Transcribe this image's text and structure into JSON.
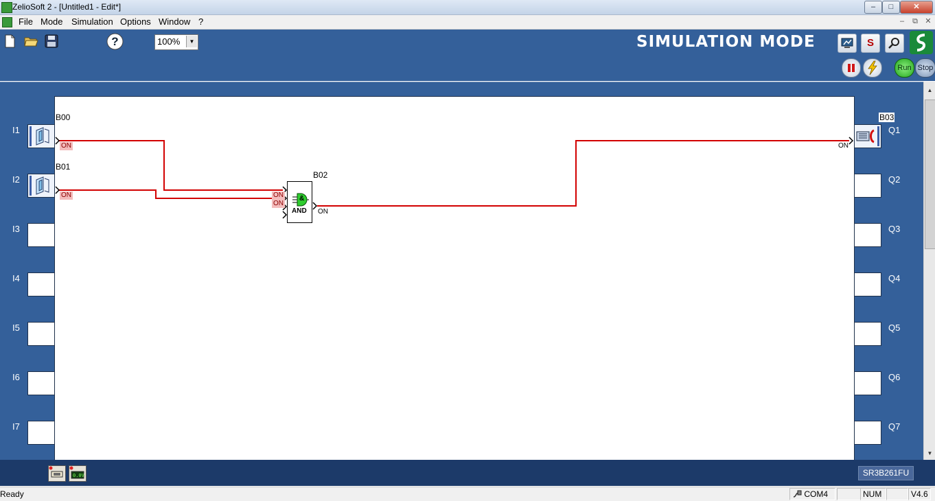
{
  "window": {
    "title": "ZelioSoft 2 - [Untitled1 - Edit*]",
    "controls": {
      "minimize": "–",
      "maximize": "□",
      "close": "✕"
    }
  },
  "menu": {
    "items": [
      "File",
      "Mode",
      "Simulation",
      "Options",
      "Window",
      "?"
    ],
    "mdi_controls": {
      "minimize": "–",
      "restore": "⧉",
      "close": "✕"
    }
  },
  "toolbar": {
    "zoom": "100%",
    "mode_banner": "SIMULATION MODE",
    "s_button": "S",
    "run_label": "Run",
    "stop_label": "Stop"
  },
  "diagram": {
    "inputs": [
      {
        "label": "I1",
        "block": "B00",
        "state": "ON",
        "used": true
      },
      {
        "label": "I2",
        "block": "B01",
        "state": "ON",
        "used": true
      },
      {
        "label": "I3",
        "used": false
      },
      {
        "label": "I4",
        "used": false
      },
      {
        "label": "I5",
        "used": false
      },
      {
        "label": "I6",
        "used": false
      },
      {
        "label": "I7",
        "used": false
      }
    ],
    "outputs": [
      {
        "label": "Q1",
        "block": "B03",
        "state": "ON",
        "used": true
      },
      {
        "label": "Q2",
        "used": false
      },
      {
        "label": "Q3",
        "used": false
      },
      {
        "label": "Q4",
        "used": false
      },
      {
        "label": "Q5",
        "used": false
      },
      {
        "label": "Q6",
        "used": false
      },
      {
        "label": "Q7",
        "used": false
      }
    ],
    "and_block": {
      "name": "B02",
      "symbol": "&",
      "text": "AND",
      "input_states": [
        "ON",
        "ON"
      ],
      "output_state": "ON"
    },
    "wire_color": "#d20000"
  },
  "bottom": {
    "model": "SR3B261FU",
    "analog_display": "0.0V"
  },
  "status": {
    "text": "Ready",
    "port": "COM4",
    "num": "NUM",
    "version": "V4.6"
  }
}
